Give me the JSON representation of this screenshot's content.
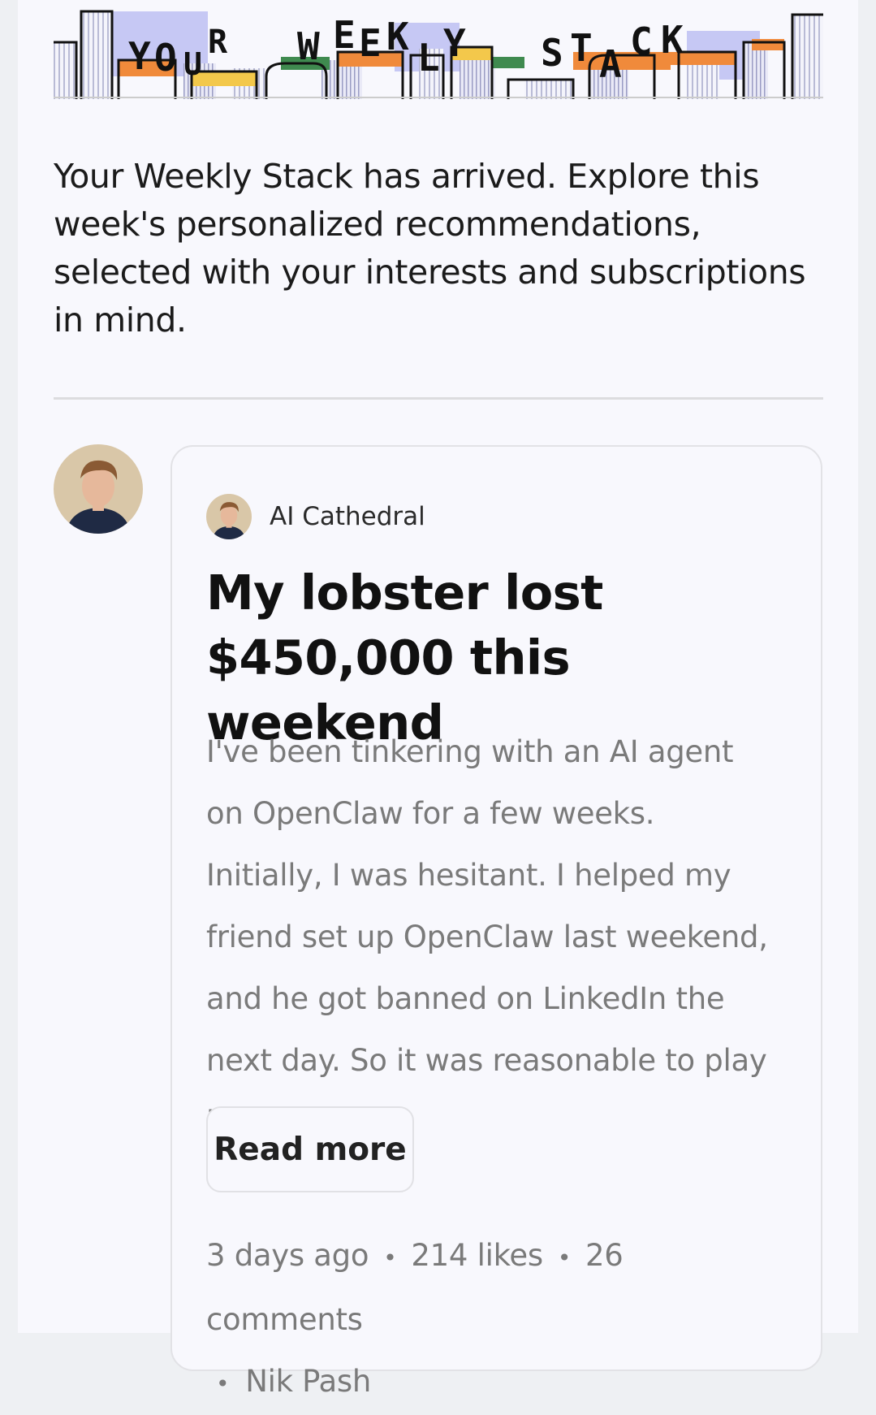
{
  "banner": {
    "letters": [
      "Y",
      "O",
      "U",
      "R",
      "W",
      "E",
      "E",
      "K",
      "L",
      "Y",
      "S",
      "T",
      "A",
      "C",
      "K"
    ]
  },
  "intro_text": "Your Weekly Stack has arrived. Explore this week's personalized recommendations, selected with your interests and subscriptions in mind.",
  "post": {
    "publication": "AI Cathedral",
    "title": "My lobster lost $450,000 this weekend",
    "excerpt": "I've been tinkering with an AI agent on OpenClaw for a few weeks. Initially, I was hesitant. I helped my friend set up OpenClaw last weekend, and he got banned on LinkedIn the next day. So it was reasonable to play it safe....",
    "read_more_label": "Read more",
    "time_ago": "3 days ago",
    "likes": "214 likes",
    "comments": "26 comments",
    "author": "Nik Pash"
  },
  "colors": {
    "page_bg": "#f8f8fd",
    "accent_orange": "#f08a3b",
    "accent_yellow": "#f3c84b",
    "accent_green": "#3f8a4f",
    "accent_lavender": "#c6c8f4"
  }
}
